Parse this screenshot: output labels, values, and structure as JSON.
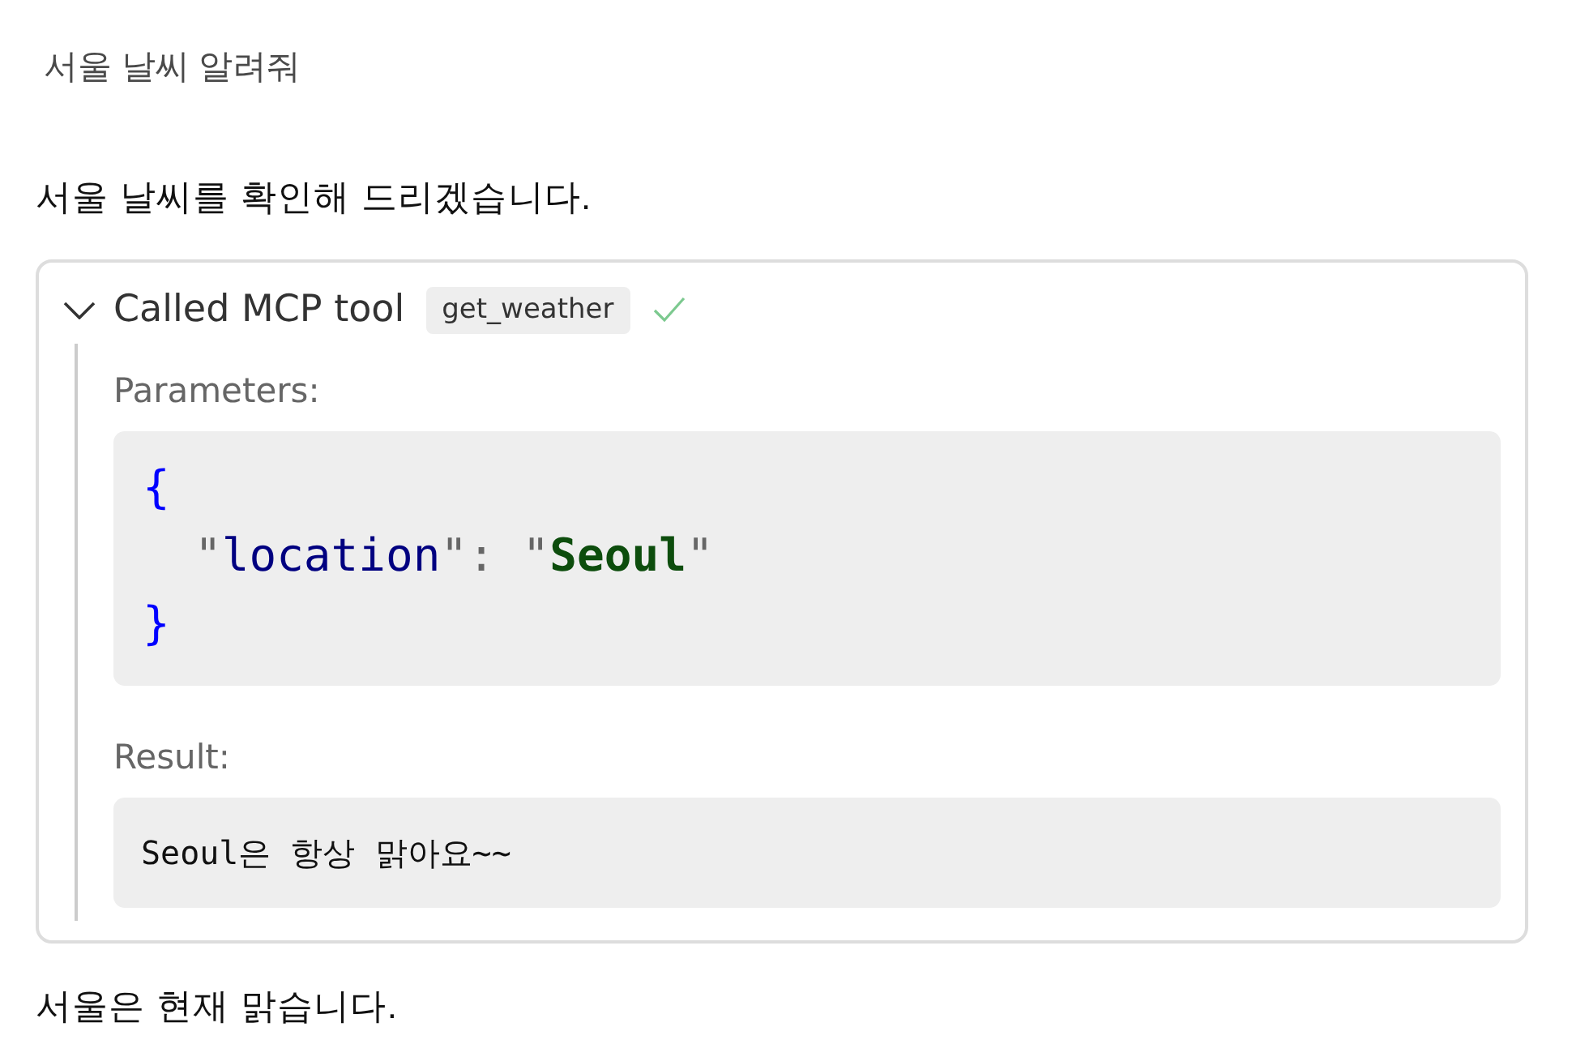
{
  "messages": [
    {
      "kind": "user",
      "text": "서울 날씨 알려줘"
    },
    {
      "kind": "assistant",
      "text": "서울 날씨를 확인해 드리겠습니다."
    },
    {
      "kind": "tool_call",
      "expanded": true,
      "title": "Called MCP tool",
      "tool_name": "get_weather",
      "succeeded": true,
      "parameters_label": "Parameters:",
      "parameters": {
        "open": [
          {
            "kind": "brace",
            "text": "{"
          }
        ],
        "members": [
          [
            {
              "kind": "punct",
              "text": "\""
            },
            {
              "kind": "key",
              "text": "location"
            },
            {
              "kind": "punct",
              "text": "\": \""
            },
            {
              "kind": "string",
              "text": "Seoul"
            },
            {
              "kind": "punct",
              "text": "\""
            }
          ]
        ],
        "close": [
          {
            "kind": "brace",
            "text": "}"
          }
        ]
      },
      "result_label": "Result:",
      "result": "Seoul은 항상 맑아요~~"
    },
    {
      "kind": "assistant",
      "text": "서울은 현재 맑습니다."
    }
  ]
}
